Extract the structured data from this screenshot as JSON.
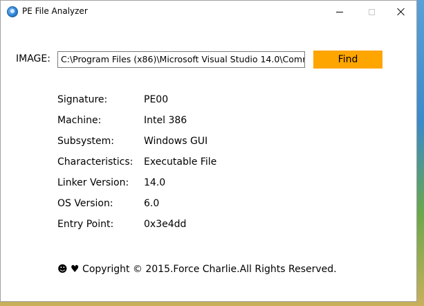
{
  "window": {
    "title": "PE File Analyzer",
    "icon": "app-globe-icon"
  },
  "titlebar_buttons": {
    "minimize": "minimize-icon",
    "maximize": "maximize-icon",
    "close": "close-icon"
  },
  "image_row": {
    "label": "IMAGE:",
    "path_value": "C:\\Program Files (x86)\\Microsoft Visual Studio 14.0\\Comm",
    "find_label": "Find",
    "find_color": "#ffa500"
  },
  "info": [
    {
      "key": "Signature:",
      "value": "PE00"
    },
    {
      "key": "Machine:",
      "value": "Intel 386"
    },
    {
      "key": "Subsystem:",
      "value": "Windows GUI"
    },
    {
      "key": "Characteristics:",
      "value": "Executable File"
    },
    {
      "key": "Linker Version:",
      "value": "14.0"
    },
    {
      "key": "OS Version:",
      "value": "6.0"
    },
    {
      "key": "Entry Point:",
      "value": "0x3e4dd"
    }
  ],
  "footer": {
    "text": "☻ ♥ Copyright © 2015.Force Charlie.All Rights Reserved."
  }
}
